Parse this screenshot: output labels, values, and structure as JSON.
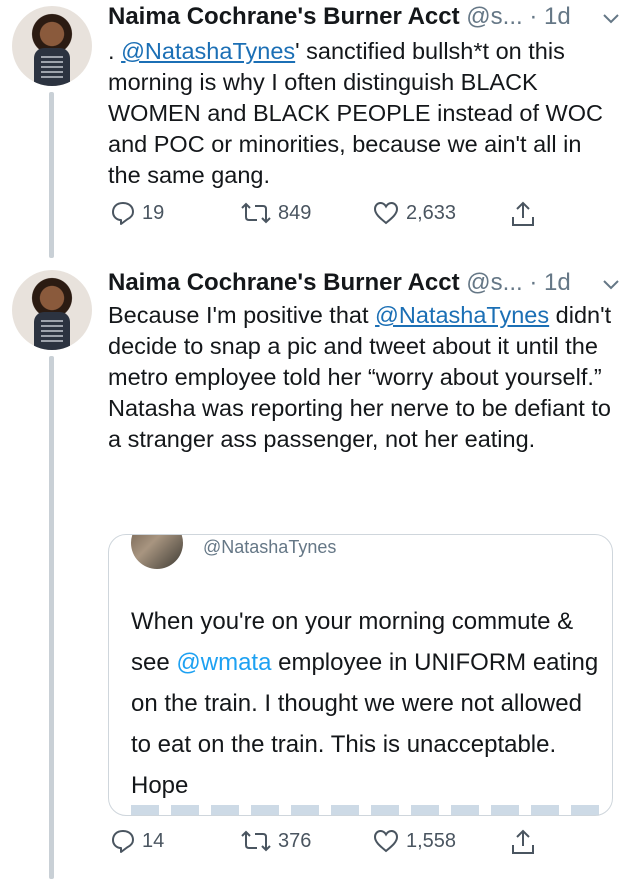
{
  "tweets": [
    {
      "name": "Naima Cochrane's Burner Acct",
      "handle": "@s...",
      "time": "· 1d",
      "body_prefix": ". ",
      "mention": "@NatashaTynes",
      "body_rest": "' sanctified bullsh*t on this morning is why I often distinguish BLACK WOMEN and BLACK PEOPLE instead of WOC and POC or minorities, because we ain't all in the same gang.",
      "replies": "19",
      "retweets": "849",
      "likes": "2,633"
    },
    {
      "name": "Naima Cochrane's Burner Acct",
      "handle": "@s...",
      "time": "· 1d",
      "body_prefix": "Because I'm positive that ",
      "mention": "@NatashaTynes",
      "body_rest": " didn't decide to snap a pic and tweet about it until the metro employee told her “worry about yourself.”",
      "body_line2": "Natasha was reporting her nerve to be defiant to a stranger ass passenger, not her eating.",
      "replies": "14",
      "retweets": "376",
      "likes": "1,558"
    }
  ],
  "quote": {
    "handle": "@NatashaTynes",
    "text_prefix": "When you're on your morning commute & see ",
    "link": "@wmata",
    "text_rest": " employee in UNIFORM eating on the train. I thought we were not allowed to eat on the train. This is unacceptable. Hope"
  },
  "icons": [
    "reply-icon",
    "retweet-icon",
    "like-icon",
    "share-icon",
    "chevron-down-icon"
  ],
  "colors": {
    "mention": "#1b6fb5",
    "link": "#1da1f2",
    "muted": "#657786",
    "thread_line": "#c9d0d6"
  }
}
